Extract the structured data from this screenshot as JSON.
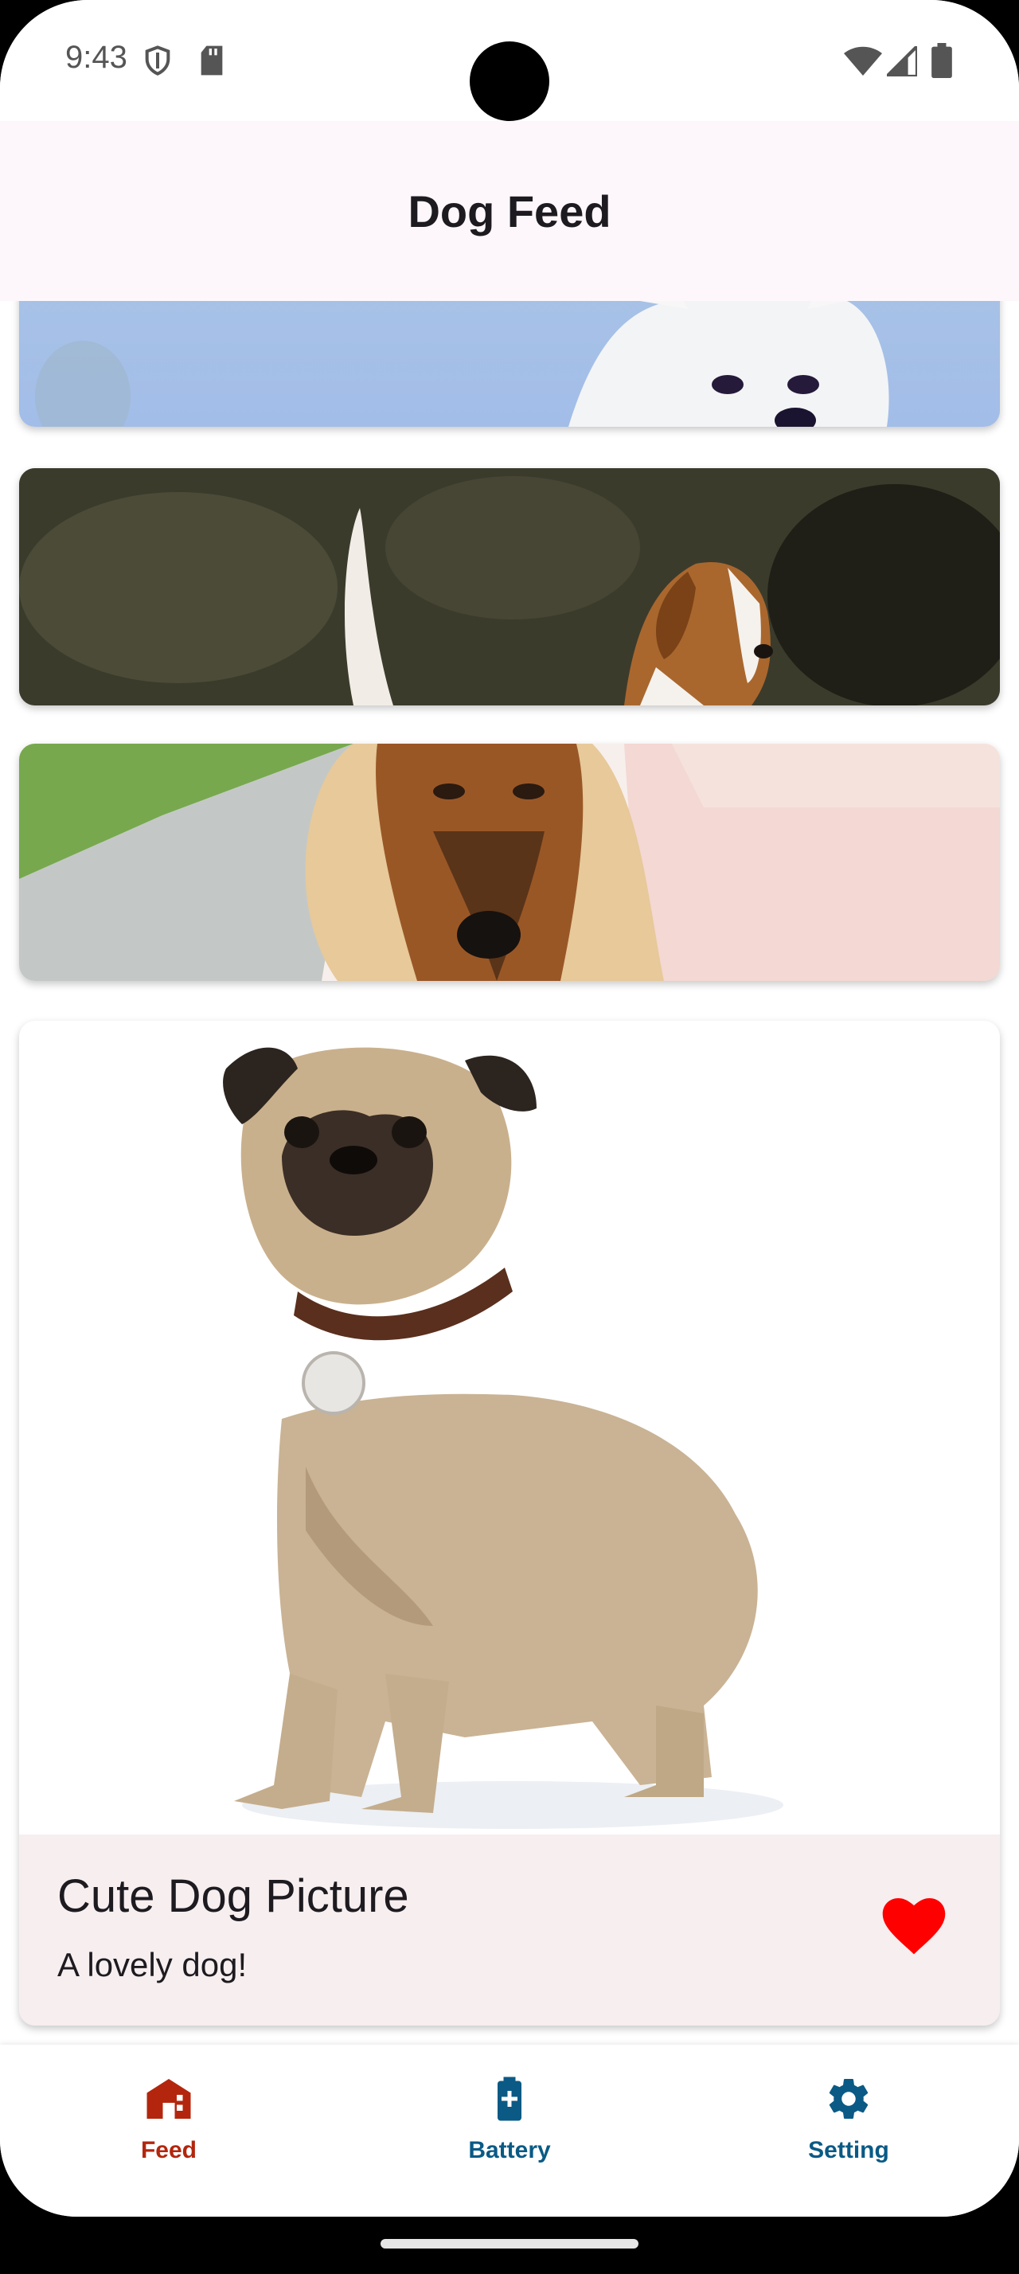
{
  "status_bar": {
    "time": "9:43",
    "icons": [
      "shield-icon",
      "sd-card-icon",
      "wifi-icon",
      "signal-icon",
      "battery-icon"
    ]
  },
  "app_bar": {
    "title": "Dog Feed"
  },
  "feed": {
    "cards": [
      {
        "image": "white-spitz-dog-photo"
      },
      {
        "image": "beagle-hound-dog-photo"
      },
      {
        "image": "afghan-hound-dog-photo"
      },
      {
        "image": "pug-dog-photo",
        "title": "Cute Dog Picture",
        "description": "A lovely dog!",
        "liked": true
      }
    ]
  },
  "bottom_nav": {
    "items": [
      {
        "label": "Feed",
        "icon": "home-icon",
        "active": true
      },
      {
        "label": "Battery",
        "icon": "battery-plus-icon",
        "active": false
      },
      {
        "label": "Setting",
        "icon": "gear-icon",
        "active": false
      }
    ]
  },
  "colors": {
    "active_nav": "#b3260d",
    "inactive_nav": "#0a5a85",
    "heart": "#ff0000",
    "app_bar_bg": "#fdf7fb",
    "caption_bg": "#f7eeef"
  }
}
